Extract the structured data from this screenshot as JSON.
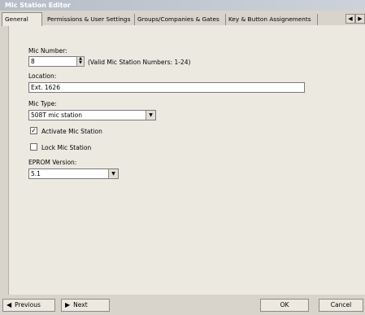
{
  "window": {
    "title": "Mic Station Editor"
  },
  "tabs": [
    {
      "label": "General"
    },
    {
      "label": "Permissions & User Settings"
    },
    {
      "label": "Groups/Companies & Gates"
    },
    {
      "label": "Key & Button Assignements"
    }
  ],
  "form": {
    "mic_number_label": "Mic Number:",
    "mic_number_value": "8",
    "mic_number_hint": "(Valid Mic Station Numbers: 1-24)",
    "location_label": "Location:",
    "location_value": "Ext. 1626",
    "mic_type_label": "Mic Type:",
    "mic_type_value": "508T mic station",
    "activate_label": "Activate Mic Station",
    "activate_checked": true,
    "activate_mark": "✓",
    "lock_label": "Lock Mic Station",
    "lock_checked": false,
    "eprom_label": "EPROM Version:",
    "eprom_value": "5.1"
  },
  "buttons": {
    "previous": "Previous",
    "next": "Next",
    "ok": "OK",
    "cancel": "Cancel"
  }
}
